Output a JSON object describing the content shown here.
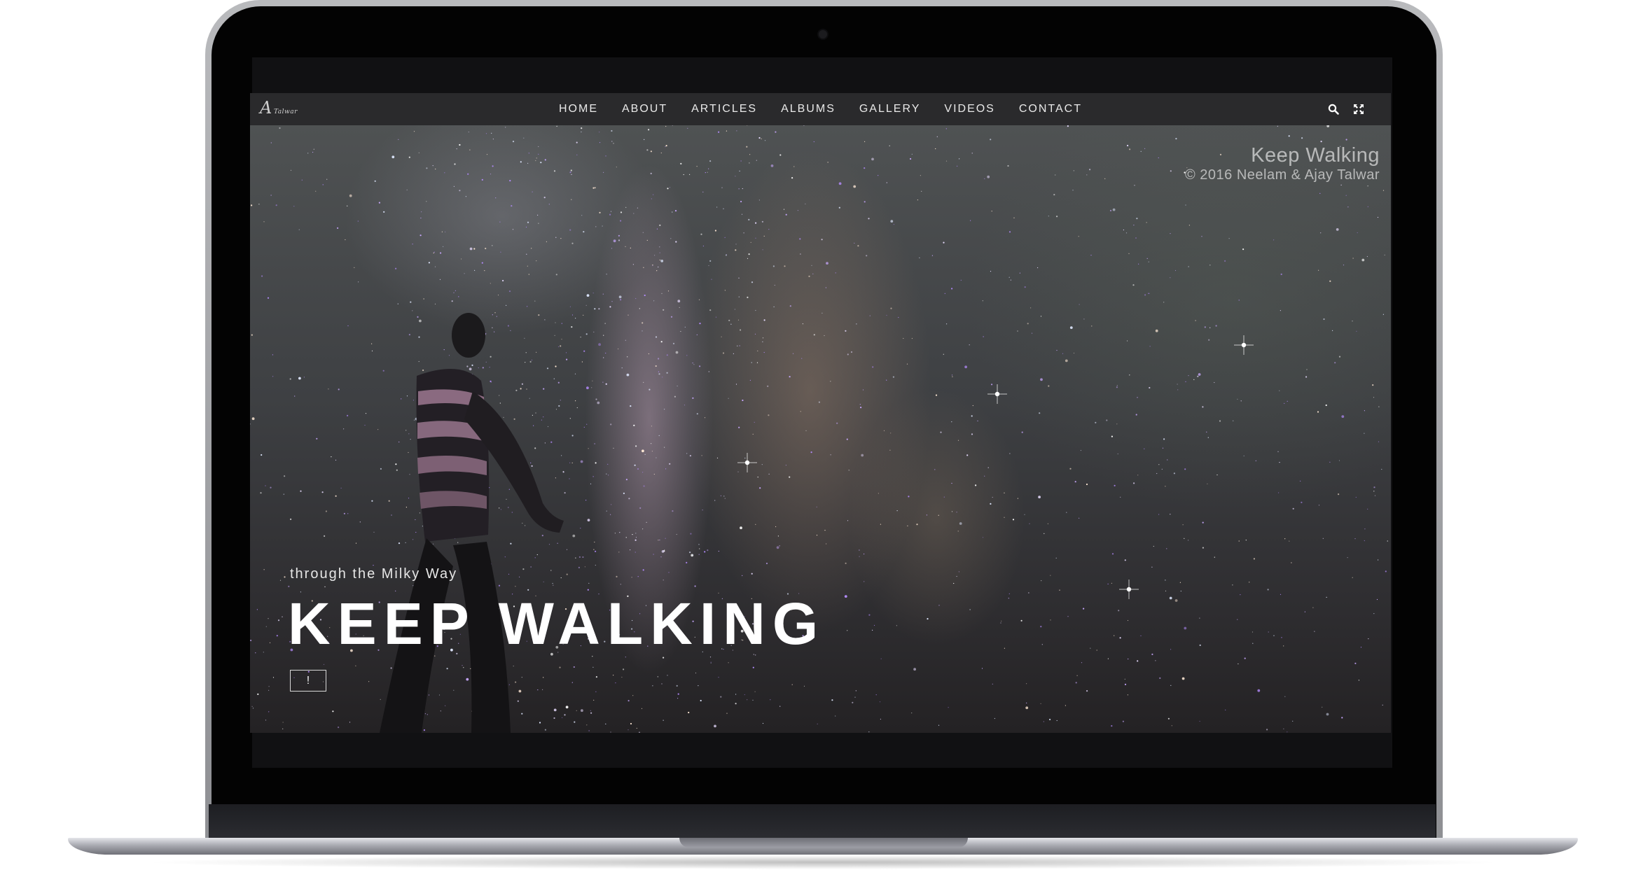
{
  "nav": {
    "logo_text": "Talwar",
    "items": [
      {
        "label": "HOME"
      },
      {
        "label": "ABOUT"
      },
      {
        "label": "ARTICLES"
      },
      {
        "label": "ALBUMS"
      },
      {
        "label": "GALLERY"
      },
      {
        "label": "VIDEOS"
      },
      {
        "label": "CONTACT"
      }
    ],
    "icons": [
      "search-icon",
      "fullscreen-icon"
    ]
  },
  "hero": {
    "credit_title": "Keep Walking",
    "credit_copyright": "© 2016 Neelam & Ajay Talwar",
    "subtitle": "through the Milky Way",
    "title": "KEEP WALKING",
    "button_label": "!"
  },
  "colors": {
    "nav_background": "#2a2a2c",
    "nav_text": "#e9e9e9",
    "title_text": "#ffffff"
  }
}
